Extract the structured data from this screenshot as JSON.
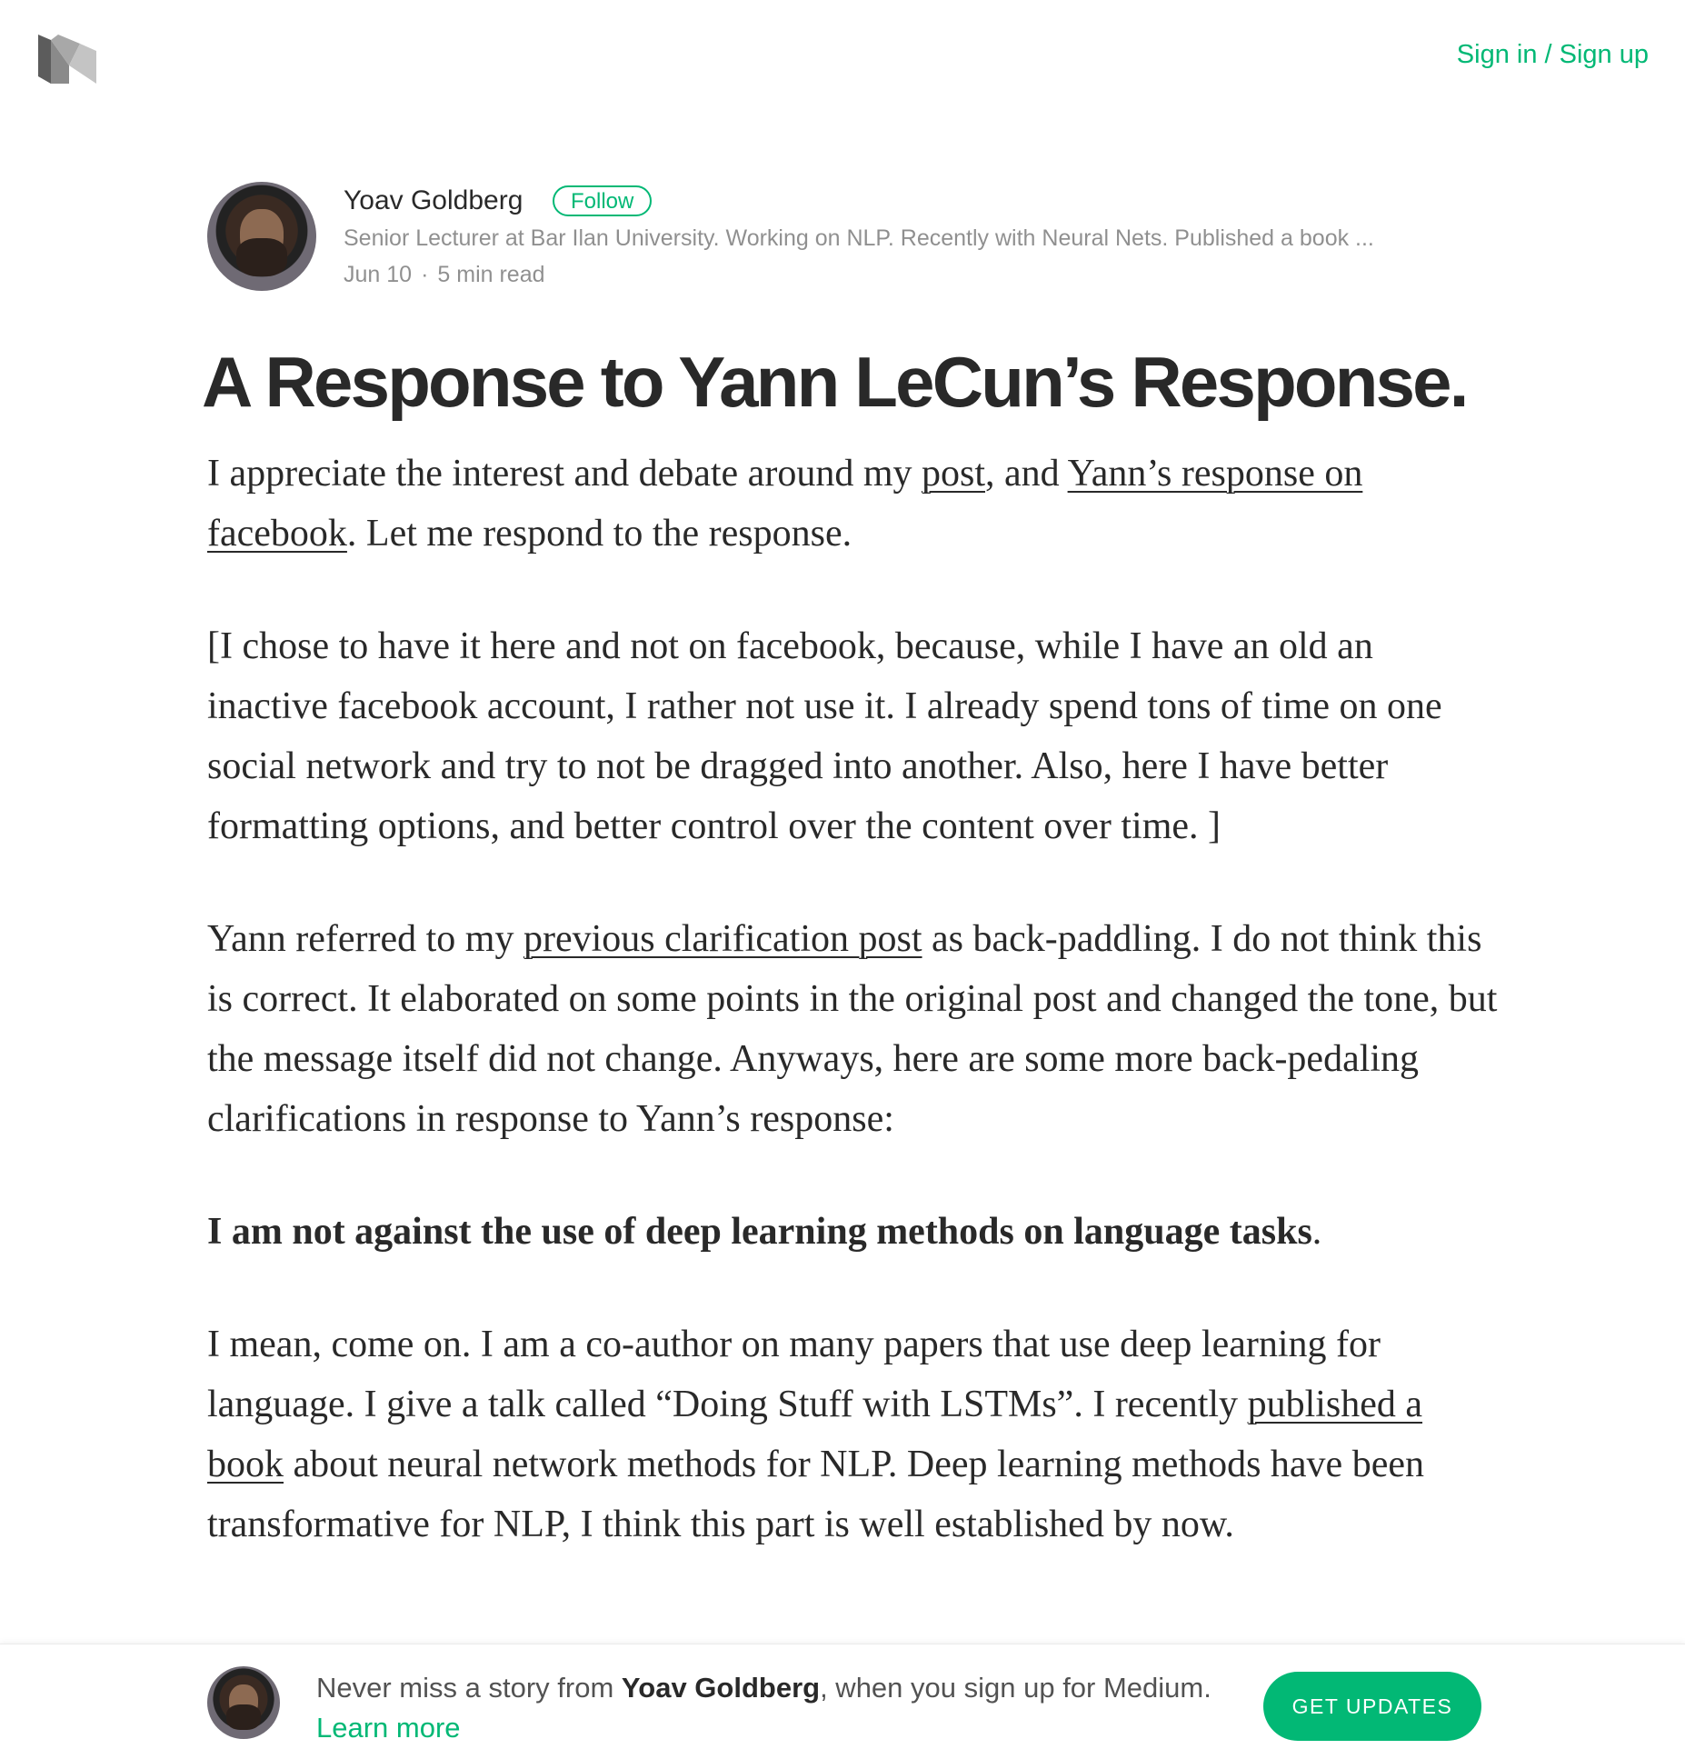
{
  "header": {
    "logo_icon": "medium-logo-icon",
    "signin_label": "Sign in / Sign up",
    "accent_color": "#02b875"
  },
  "author": {
    "name": "Yoav Goldberg",
    "follow_label": "Follow",
    "bio": "Senior Lecturer at Bar Ilan University. Working on NLP. Recently with Neural Nets. Published a book ...",
    "date": "Jun 10",
    "separator": "·",
    "read_time": "5 min read"
  },
  "article": {
    "title": "A Response to Yann LeCun’s Response.",
    "p1": {
      "t1": "I appreciate the interest and debate around my ",
      "link1": "post",
      "t2": ", and ",
      "link2": "Yann’s response on facebook",
      "t3": ". Let me respond to the response."
    },
    "p2": "[I chose to have it here and not on facebook, because, while I have an old an inactive facebook account, I rather not use it. I already spend tons of time on one social network and try to not be dragged into another. Also, here I have better formatting options, and better control over the content over time. ]",
    "p3": {
      "t1": "Yann referred to my ",
      "link1": "previous clarification post",
      "t2": " as back-paddling. I do not think this is correct. It elaborated on some points in the original post and changed the tone, but the message itself did not change. Anyways, here are some more back-pedaling clarifications in response to Yann’s response:"
    },
    "p4": {
      "bold": "I am not against the use of deep learning methods on language tasks",
      "end": "."
    },
    "p5": {
      "t1": "I mean, come on. I am a co-author on many papers that use deep learning for language. I give a talk called “Doing Stuff with LSTMs”. I recently ",
      "link1": "published a book",
      "t2": " about neural network methods for NLP. Deep learning methods have been transformative for NLP, I think this part is well established by now."
    }
  },
  "footer": {
    "t1": "Never miss a story from ",
    "author": "Yoav Goldberg",
    "t2": ", when you sign up for Medium. ",
    "learn_more": "Learn more",
    "cta_label": "GET UPDATES"
  }
}
